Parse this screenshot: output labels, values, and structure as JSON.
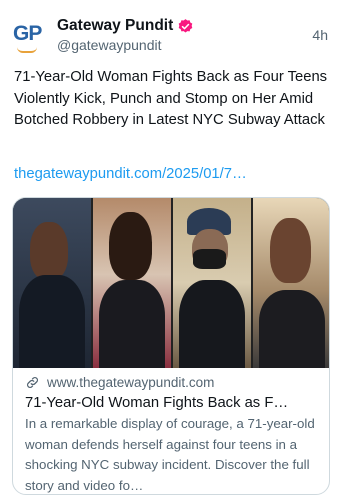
{
  "post": {
    "author_name": "Gateway Pundit",
    "author_handle": "@gatewaypundit",
    "avatar_text": "GP",
    "timestamp": "4h",
    "text": "71-Year-Old Woman Fights Back as Four Teens Violently Kick, Punch and Stomp on Her Amid Botched Robbery in Latest NYC Subway Attack",
    "link_text": "thegatewaypundit.com/2025/01/7…"
  },
  "card": {
    "domain": "www.thegatewaypundit.com",
    "title": "71-Year-Old Woman Fights Back as F…",
    "description": "In a remarkable display of courage, a 71-year-old woman defends herself against four teens in a shocking NYC subway incident. Discover the full story and video fo…"
  },
  "colors": {
    "verified_badge": "#f91880",
    "link": "#1d9bf0",
    "muted": "#536471"
  },
  "icons": [
    "verified-badge-icon",
    "link-icon"
  ]
}
